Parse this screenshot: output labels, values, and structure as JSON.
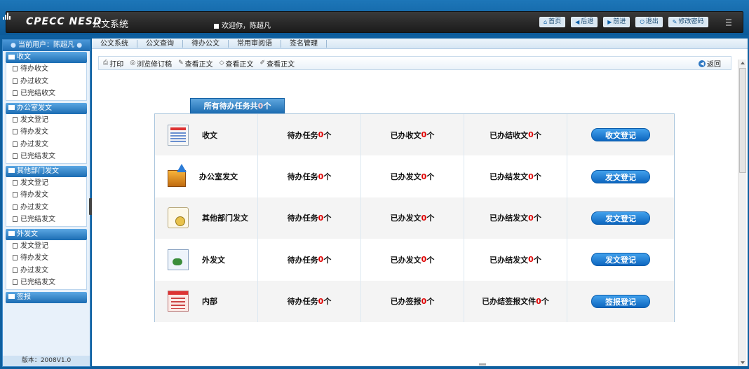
{
  "header": {
    "logo": "CPECC NESD",
    "title": "公文系统",
    "welcome": "欢迎你，陈超凡",
    "buttons": [
      {
        "label": "首页",
        "icon": "home-icon"
      },
      {
        "label": "后退",
        "icon": "arrow-left-icon"
      },
      {
        "label": "前进",
        "icon": "arrow-right-icon"
      },
      {
        "label": "退出",
        "icon": "power-icon"
      },
      {
        "label": "修改密码",
        "icon": "key-icon"
      }
    ]
  },
  "sidebar": {
    "current_user": "当前用户：陈超凡",
    "sections": [
      {
        "title": "收文",
        "items": [
          "待办收文",
          "办过收文",
          "已完结收文"
        ]
      },
      {
        "title": "办公室发文",
        "items": [
          "发文登记",
          "待办发文",
          "办过发文",
          "已完结发文"
        ]
      },
      {
        "title": "其他部门发文",
        "items": [
          "发文登记",
          "待办发文",
          "办过发文",
          "已完结发文"
        ]
      },
      {
        "title": "外发文",
        "items": [
          "发文登记",
          "待办发文",
          "办过发文",
          "已完结发文"
        ]
      },
      {
        "title": "签报",
        "items": []
      }
    ],
    "version": "版本：2008V1.0"
  },
  "tabs": [
    "公文系统",
    "公文查询",
    "待办公文",
    "常用审阅语",
    "签名管理"
  ],
  "toolbar": {
    "items": [
      "打印",
      "浏览修订稿",
      "查看正文",
      "查看正文",
      "查看正文"
    ],
    "back": "返回"
  },
  "summary": {
    "prefix": "所有待办任务共",
    "count": "0",
    "suffix": "个"
  },
  "rows": [
    {
      "name": "收文",
      "icon": "list-document-icon",
      "stats": [
        {
          "label": "待办任务",
          "count": "0"
        },
        {
          "label": "已办收文",
          "count": "0"
        },
        {
          "label": "已办结收文",
          "count": "0"
        }
      ],
      "button": "收文登记"
    },
    {
      "name": "办公室发文",
      "icon": "upload-folder-icon",
      "stats": [
        {
          "label": "待办任务",
          "count": "0"
        },
        {
          "label": "已办发文",
          "count": "0"
        },
        {
          "label": "已办结发文",
          "count": "0"
        }
      ],
      "button": "发文登记"
    },
    {
      "name": "其他部门发文",
      "icon": "paper-seal-icon",
      "stats": [
        {
          "label": "待办任务",
          "count": "0"
        },
        {
          "label": "已办发文",
          "count": "0"
        },
        {
          "label": "已办结发文",
          "count": "0"
        }
      ],
      "button": "发文登记"
    },
    {
      "name": "外发文",
      "icon": "external-document-icon",
      "stats": [
        {
          "label": "待办任务",
          "count": "0"
        },
        {
          "label": "已办发文",
          "count": "0"
        },
        {
          "label": "已办结发文",
          "count": "0"
        }
      ],
      "button": "发文登记"
    },
    {
      "name": "内部",
      "icon": "checklist-icon",
      "stats": [
        {
          "label": "待办任务",
          "count": "0"
        },
        {
          "label": "已办签报",
          "count": "0"
        },
        {
          "label": "已办结签报文件",
          "count": "0"
        }
      ],
      "button": "签报登记"
    }
  ],
  "unit": "个",
  "colors": {
    "accent": "#1b6cb2",
    "count": "#e00000",
    "header": "#1d76b8"
  }
}
